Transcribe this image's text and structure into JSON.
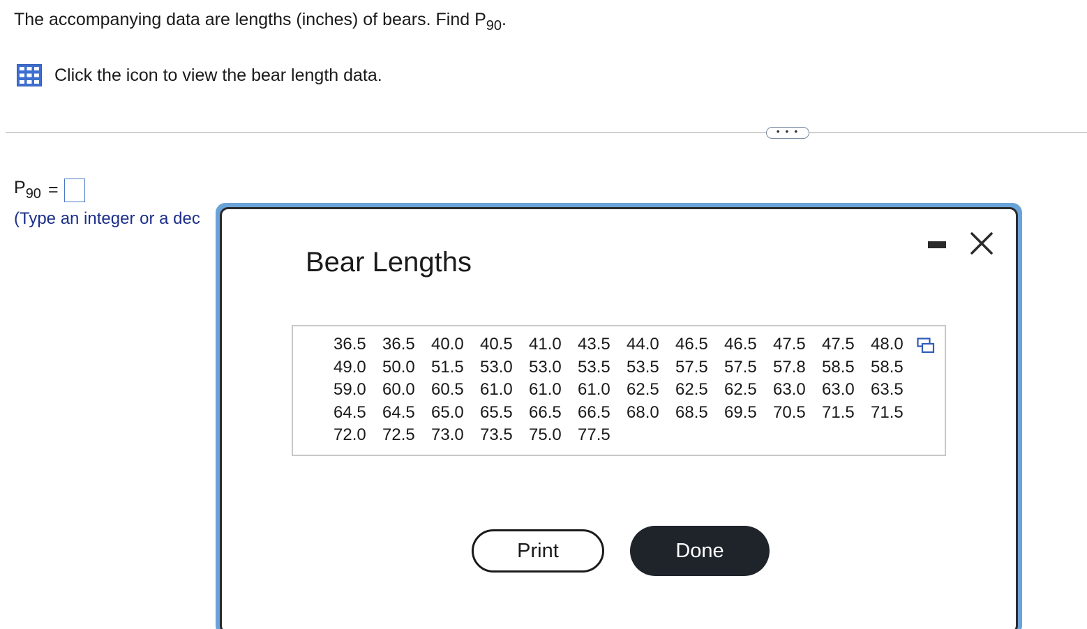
{
  "question": {
    "text": "The accompanying data are lengths (inches) of bears. Find P",
    "subscript": "90",
    "suffix": "."
  },
  "data_link": {
    "icon": "table-grid-icon",
    "text": "Click the icon to view the bear length data."
  },
  "more_button": {
    "label": "• • •"
  },
  "answer": {
    "label": "P",
    "subscript": "90",
    "equals": "=",
    "value": "",
    "hint": "(Type an integer or a dec"
  },
  "modal": {
    "title": "Bear Lengths",
    "minimize_icon": "minimize-icon",
    "close_icon": "close-icon",
    "copy_icon": "copy-icon",
    "data": [
      "36.5",
      "36.5",
      "40.0",
      "40.5",
      "41.0",
      "43.5",
      "44.0",
      "46.5",
      "46.5",
      "47.5",
      "47.5",
      "48.0",
      "49.0",
      "50.0",
      "51.5",
      "53.0",
      "53.0",
      "53.5",
      "53.5",
      "57.5",
      "57.5",
      "57.8",
      "58.5",
      "58.5",
      "59.0",
      "60.0",
      "60.5",
      "61.0",
      "61.0",
      "61.0",
      "62.5",
      "62.5",
      "62.5",
      "63.0",
      "63.0",
      "63.5",
      "64.5",
      "64.5",
      "65.0",
      "65.5",
      "66.5",
      "66.5",
      "68.0",
      "68.5",
      "69.5",
      "70.5",
      "71.5",
      "71.5",
      "72.0",
      "72.5",
      "73.0",
      "73.5",
      "75.0",
      "77.5"
    ],
    "print_label": "Print",
    "done_label": "Done"
  },
  "colors": {
    "modal_border_accent": "#6aa3d8",
    "hint_text": "#1c2f8a",
    "answer_box_border": "#4a78c8",
    "done_button_bg": "#1f242b",
    "icon_blue": "#3d6fd0"
  }
}
